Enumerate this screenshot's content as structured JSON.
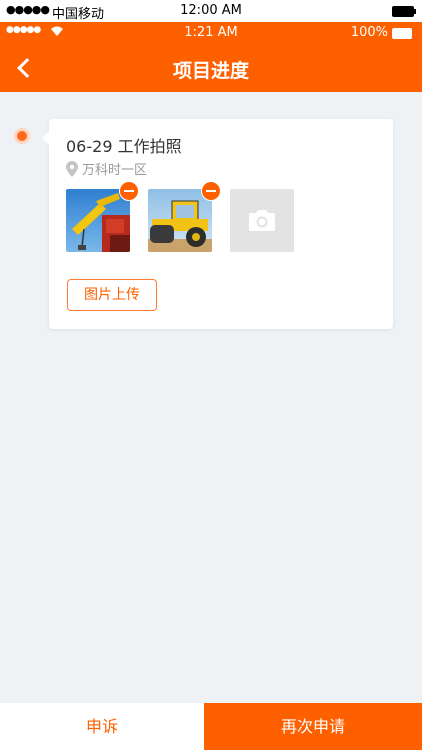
{
  "system_status": {
    "signal": "●●●●●",
    "carrier": "中国移动",
    "time": "12:00 AM"
  },
  "app_status": {
    "signal": "●●●●●",
    "wifi": "wifi-icon",
    "time": "1:21 AM",
    "battery": "100%"
  },
  "navbar": {
    "back_icon": "chevron-left-icon",
    "title": "项目进度"
  },
  "record": {
    "title": "06-29 工作拍照",
    "location_icon": "map-pin-icon",
    "location": "万科时一区",
    "photos": [
      {
        "name": "crane-photo"
      },
      {
        "name": "roller-photo"
      }
    ],
    "add_photo_icon": "camera-icon",
    "upload_label": "图片上传"
  },
  "bottom": {
    "appeal_label": "申诉",
    "reapply_label": "再次申请"
  },
  "colors": {
    "accent": "#fe6000",
    "background": "#eef2f5"
  }
}
